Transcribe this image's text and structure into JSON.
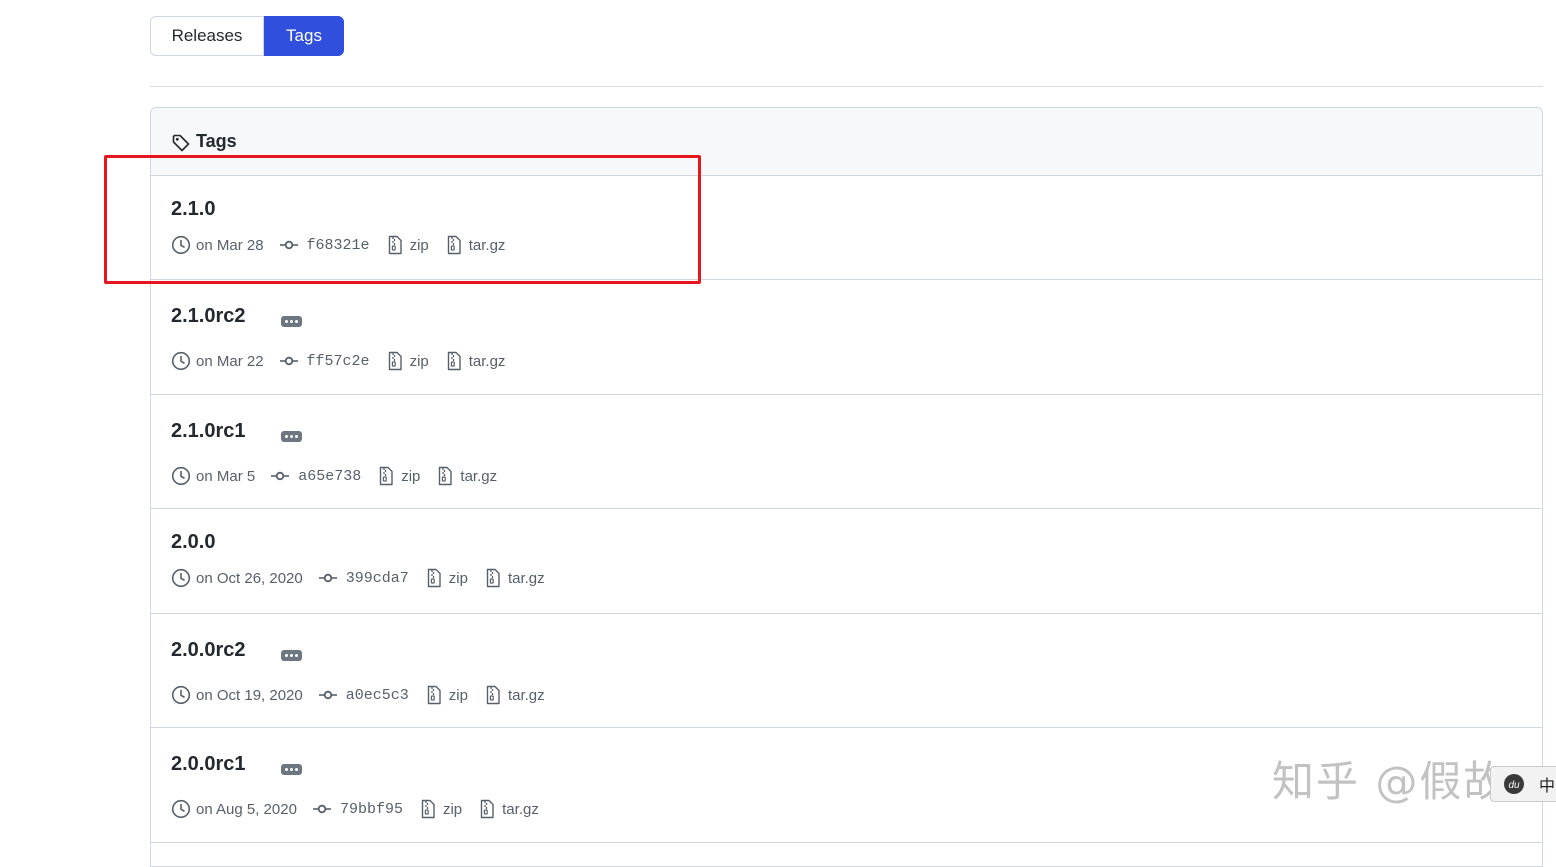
{
  "tabs": {
    "releases": "Releases",
    "tags": "Tags"
  },
  "box": {
    "title": "Tags"
  },
  "tags": [
    {
      "name": "2.1.0",
      "date": "on Mar 28",
      "sha": "f68321e",
      "zip": "zip",
      "targz": "tar.gz",
      "has_more": false
    },
    {
      "name": "2.1.0rc2",
      "date": "on Mar 22",
      "sha": "ff57c2e",
      "zip": "zip",
      "targz": "tar.gz",
      "has_more": true
    },
    {
      "name": "2.1.0rc1",
      "date": "on Mar 5",
      "sha": "a65e738",
      "zip": "zip",
      "targz": "tar.gz",
      "has_more": true
    },
    {
      "name": "2.0.0",
      "date": "on Oct 26, 2020",
      "sha": "399cda7",
      "zip": "zip",
      "targz": "tar.gz",
      "has_more": false
    },
    {
      "name": "2.0.0rc2",
      "date": "on Oct 19, 2020",
      "sha": "a0ec5c3",
      "zip": "zip",
      "targz": "tar.gz",
      "has_more": true
    },
    {
      "name": "2.0.0rc1",
      "date": "on Aug 5, 2020",
      "sha": "79bbf95",
      "zip": "zip",
      "targz": "tar.gz",
      "has_more": true
    }
  ],
  "watermark": "知乎 @假故",
  "ime": {
    "label": "中",
    "icon": "paw-icon"
  },
  "colors": {
    "accent": "#2f4fdc",
    "highlight": "#e5161d"
  }
}
